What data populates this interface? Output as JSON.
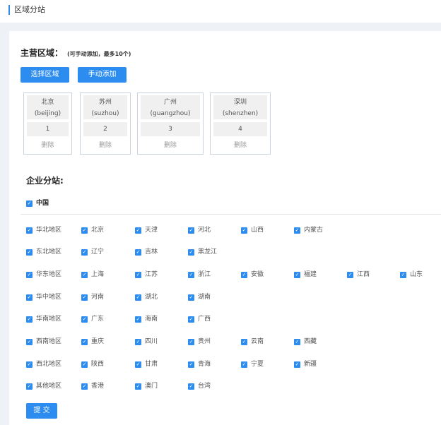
{
  "header": {
    "title": "区域分站"
  },
  "main_region": {
    "title": "主营区域：",
    "note": "(可手动添加，最多10个)",
    "select_button": "选择区域",
    "manual_button": "手动添加",
    "cards": [
      {
        "name": "北京",
        "pinyin": "(beijing)",
        "index": "1",
        "delete": "删除"
      },
      {
        "name": "苏州",
        "pinyin": "(suzhou)",
        "index": "2",
        "delete": "删除"
      },
      {
        "name": "广州",
        "pinyin": "(guangzhou)",
        "index": "3",
        "delete": "删除"
      },
      {
        "name": "深圳",
        "pinyin": "(shenzhen)",
        "index": "4",
        "delete": "删除"
      }
    ]
  },
  "branches": {
    "title": "企业分站:",
    "country": "中国",
    "check_glyph": "✓",
    "rows": [
      [
        "华北地区",
        "北京",
        "天津",
        "河北",
        "山西",
        "内蒙古"
      ],
      [
        "东北地区",
        "辽宁",
        "吉林",
        "黑龙江"
      ],
      [
        "华东地区",
        "上海",
        "江苏",
        "浙江",
        "安徽",
        "福建",
        "江西",
        "山东"
      ],
      [
        "华中地区",
        "河南",
        "湖北",
        "湖南"
      ],
      [
        "华南地区",
        "广东",
        "海南",
        "广西"
      ],
      [
        "西南地区",
        "重庆",
        "四川",
        "贵州",
        "云南",
        "西藏"
      ],
      [
        "西北地区",
        "陕西",
        "甘肃",
        "青海",
        "宁夏",
        "新疆"
      ],
      [
        "其他地区",
        "香港",
        "澳门",
        "台湾"
      ]
    ]
  },
  "submit_button": "提 交",
  "colors": {
    "accent": "#2d8cf0",
    "background": "#eef1f6"
  }
}
